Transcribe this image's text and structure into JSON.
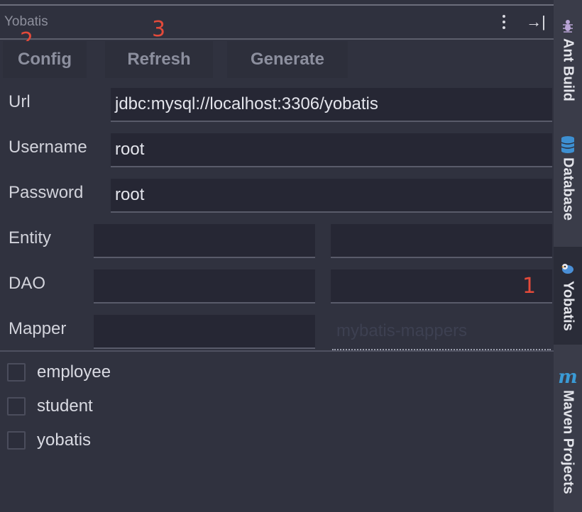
{
  "panel": {
    "title": "Yobatis"
  },
  "annotations": {
    "mark_1": "1",
    "mark_2": "2",
    "mark_3": "3"
  },
  "toolbar": {
    "config_label": "Config",
    "refresh_label": "Refresh",
    "generate_label": "Generate"
  },
  "form": {
    "url_label": "Url",
    "url_value": "jdbc:mysql://localhost:3306/yobatis",
    "username_label": "Username",
    "username_value": "root",
    "password_label": "Password",
    "password_value": "root",
    "entity_label": "Entity",
    "entity_path": "",
    "entity_package": "",
    "dao_label": "DAO",
    "dao_path": "",
    "dao_package": "",
    "mapper_label": "Mapper",
    "mapper_path": "",
    "mapper_placeholder": "mybatis-mappers"
  },
  "tables": [
    {
      "label": "employee",
      "checked": false
    },
    {
      "label": "student",
      "checked": false
    },
    {
      "label": "yobatis",
      "checked": false
    }
  ],
  "sidebar": {
    "items": [
      {
        "label": "Ant Build",
        "icon": "ant-icon",
        "active": false
      },
      {
        "label": "Database",
        "icon": "database-icon",
        "active": false
      },
      {
        "label": "Yobatis",
        "icon": "yobatis-bird-icon",
        "active": true
      },
      {
        "label": "Maven Projects",
        "icon": "maven-icon",
        "active": false
      }
    ]
  },
  "colors": {
    "background": "#30323f",
    "field_bg": "#262734",
    "annotation_red": "#e34a3a",
    "maven_blue": "#3a9bd6",
    "database_blue": "#3d8fd1"
  }
}
